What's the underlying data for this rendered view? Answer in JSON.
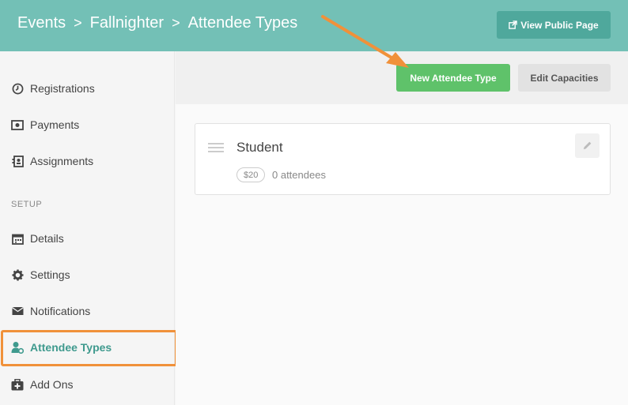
{
  "header": {
    "breadcrumb": [
      "Events",
      "Fallnighter",
      "Attendee Types"
    ],
    "separator": ">",
    "view_public_label": "View Public Page"
  },
  "sidebar": {
    "items": [
      {
        "label": "Registrations",
        "icon": "clock-icon"
      },
      {
        "label": "Payments",
        "icon": "money-icon"
      },
      {
        "label": "Assignments",
        "icon": "assignment-icon"
      }
    ],
    "setup_heading": "SETUP",
    "setup_items": [
      {
        "label": "Details",
        "icon": "calendar-icon"
      },
      {
        "label": "Settings",
        "icon": "gear-icon"
      },
      {
        "label": "Notifications",
        "icon": "envelope-icon"
      },
      {
        "label": "Attendee Types",
        "icon": "attendee-type-icon"
      },
      {
        "label": "Add Ons",
        "icon": "add-on-icon"
      }
    ]
  },
  "toolbar": {
    "new_label": "New Attendee Type",
    "edit_label": "Edit Capacities"
  },
  "attendee_types": [
    {
      "name": "Student",
      "price": "$20",
      "attendees": "0 attendees"
    }
  ],
  "colors": {
    "header": "#73c0b6",
    "accent": "#3f9a8e",
    "new_button": "#5fc26a",
    "highlight": "#f0913a"
  }
}
